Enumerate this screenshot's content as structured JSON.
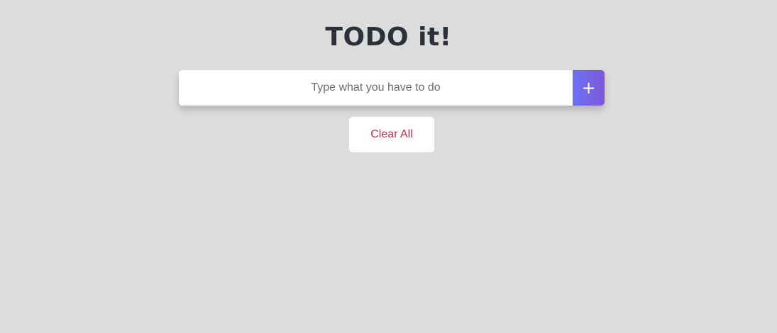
{
  "app": {
    "title": "TODO it!"
  },
  "todo_input": {
    "value": "",
    "placeholder": "Type what you have to do"
  },
  "add_button": {
    "label": "+"
  },
  "clear_button": {
    "label": "Clear All"
  },
  "colors": {
    "background": "#dcdcdc",
    "title": "#2c3038",
    "add_button_gradient_start": "#6d70f5",
    "add_button_gradient_end": "#7b58d6",
    "clear_text": "#d0284a"
  },
  "todos": []
}
